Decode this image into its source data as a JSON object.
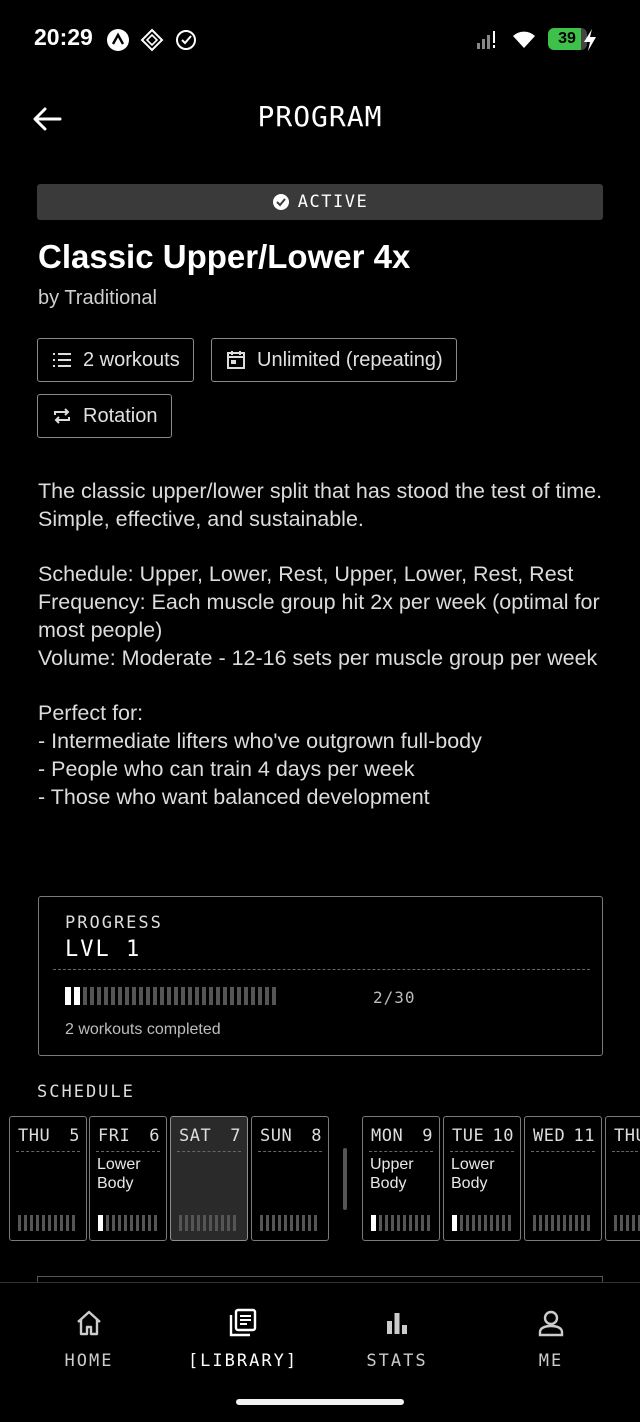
{
  "status_bar": {
    "time": "20:29",
    "battery": "39"
  },
  "header": {
    "title": "PROGRAM"
  },
  "program": {
    "status": "ACTIVE",
    "title": "Classic Upper/Lower 4x",
    "author": "by Traditional",
    "chips": {
      "workouts": "2 workouts",
      "duration": "Unlimited (repeating)",
      "mode": "Rotation"
    },
    "description": "The classic upper/lower split that has stood the test of time.\nSimple, effective, and sustainable.\n\nSchedule: Upper, Lower, Rest, Upper, Lower, Rest, Rest\nFrequency: Each muscle group hit 2x per week (optimal for most people)\nVolume: Moderate - 12-16 sets per muscle group per week\n\nPerfect for:\n- Intermediate lifters who've outgrown full-body\n- People who can train 4 days per week\n- Those who want balanced development"
  },
  "progress": {
    "label": "PROGRESS",
    "level": "LVL 1",
    "completed": 2,
    "total": 30,
    "count_text": "2/30",
    "summary": "2 workouts completed"
  },
  "schedule": {
    "label": "SCHEDULE",
    "days": [
      {
        "dow": "THU",
        "date": "5",
        "workout": "",
        "bar_on": false,
        "today": false
      },
      {
        "dow": "FRI",
        "date": "6",
        "workout": "Lower Body",
        "bar_on": true,
        "today": false
      },
      {
        "dow": "SAT",
        "date": "7",
        "workout": "",
        "bar_on": false,
        "today": true
      },
      {
        "dow": "SUN",
        "date": "8",
        "workout": "",
        "bar_on": false,
        "today": false
      },
      {
        "dow": "MON",
        "date": "9",
        "workout": "Upper Body",
        "bar_on": true,
        "today": false
      },
      {
        "dow": "TUE",
        "date": "10",
        "workout": "Lower Body",
        "bar_on": true,
        "today": false
      },
      {
        "dow": "WED",
        "date": "11",
        "workout": "",
        "bar_on": false,
        "today": false
      },
      {
        "dow": "THU",
        "date": "",
        "workout": "",
        "bar_on": false,
        "today": false
      }
    ]
  },
  "nav": {
    "home": "HOME",
    "library": "[LIBRARY]",
    "stats": "STATS",
    "me": "ME"
  }
}
